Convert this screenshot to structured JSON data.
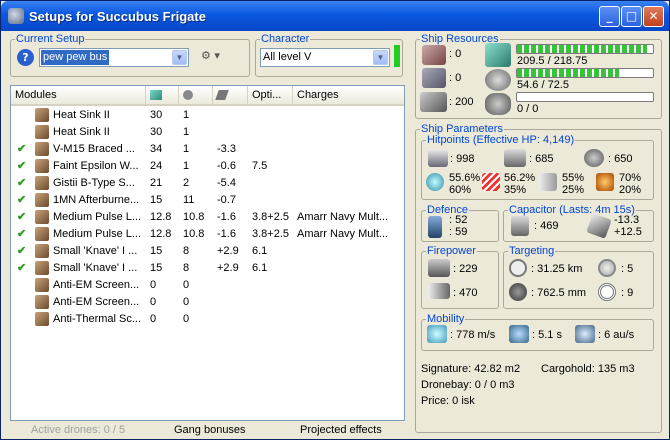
{
  "window": {
    "title": "Setups for Succubus Frigate",
    "minimize": "_",
    "maximize": "□",
    "close": "✕"
  },
  "current_setup": {
    "legend": "Current Setup",
    "value": "pew pew bus"
  },
  "character": {
    "legend": "Character",
    "value": "All level V",
    "status_color": "#22cc22"
  },
  "modules_table": {
    "headers": {
      "modules": "Modules",
      "opti": "Opti...",
      "charges": "Charges"
    },
    "rows": [
      {
        "checked": "",
        "name": "Heat Sink II",
        "c1": "30",
        "c2": "1",
        "c3": "",
        "c4": "",
        "charges": ""
      },
      {
        "checked": "",
        "name": "Heat Sink II",
        "c1": "30",
        "c2": "1",
        "c3": "",
        "c4": "",
        "charges": ""
      },
      {
        "checked": "✔",
        "name": "V-M15 Braced ...",
        "c1": "34",
        "c2": "1",
        "c3": "-3.3",
        "c4": "",
        "charges": ""
      },
      {
        "checked": "✔",
        "name": "Faint Epsilon W...",
        "c1": "24",
        "c2": "1",
        "c3": "-0.6",
        "c4": "7.5",
        "charges": ""
      },
      {
        "checked": "✔",
        "name": "Gistii B-Type S...",
        "c1": "21",
        "c2": "2",
        "c3": "-5.4",
        "c4": "",
        "charges": ""
      },
      {
        "checked": "✔",
        "name": "1MN Afterburne...",
        "c1": "15",
        "c2": "11",
        "c3": "-0.7",
        "c4": "",
        "charges": ""
      },
      {
        "checked": "✔",
        "name": "Medium Pulse L...",
        "c1": "12.8",
        "c2": "10.8",
        "c3": "-1.6",
        "c4": "3.8+2.5",
        "charges": "Amarr Navy Mult..."
      },
      {
        "checked": "✔",
        "name": "Medium Pulse L...",
        "c1": "12.8",
        "c2": "10.8",
        "c3": "-1.6",
        "c4": "3.8+2.5",
        "charges": "Amarr Navy Mult..."
      },
      {
        "checked": "✔",
        "name": "Small 'Knave' I ...",
        "c1": "15",
        "c2": "8",
        "c3": "+2.9",
        "c4": "6.1",
        "charges": ""
      },
      {
        "checked": "✔",
        "name": "Small 'Knave' I ...",
        "c1": "15",
        "c2": "8",
        "c3": "+2.9",
        "c4": "6.1",
        "charges": ""
      },
      {
        "checked": "",
        "name": "Anti-EM Screen...",
        "c1": "0",
        "c2": "0",
        "c3": "",
        "c4": "",
        "charges": ""
      },
      {
        "checked": "",
        "name": "Anti-EM Screen...",
        "c1": "0",
        "c2": "0",
        "c3": "",
        "c4": "",
        "charges": ""
      },
      {
        "checked": "",
        "name": "Anti-Thermal Sc...",
        "c1": "0",
        "c2": "0",
        "c3": "",
        "c4": "",
        "charges": ""
      }
    ]
  },
  "bottom_tabs": {
    "active_drones": "Active drones: 0 / 5",
    "gang_bonuses": "Gang bonuses",
    "projected_effects": "Projected effects"
  },
  "ship_resources": {
    "legend": "Ship Resources",
    "hardpoints_turret": ": 0",
    "hardpoints_launcher": ": 0",
    "calibration": ": 200",
    "cpu": {
      "text": "209.5 / 218.75",
      "fraction": 0.958
    },
    "powergrid": {
      "text": "54.6 / 72.5",
      "fraction": 0.753
    },
    "drone_bandwidth": {
      "text": "0 / 0",
      "fraction": 0.0
    }
  },
  "ship_parameters": {
    "legend": "Ship Parameters",
    "hitpoints": {
      "legend": "Hitpoints (Effective HP: 4,149)",
      "shield_hp": ": 998",
      "armor_hp": ": 685",
      "structure_hp": ": 650",
      "shield_res": [
        "55.6%",
        "60%"
      ],
      "armor_res": [
        "56.2%",
        "35%"
      ],
      "kinetic_res": [
        "55%",
        "25%"
      ],
      "explosive_res": [
        "70%",
        "20%"
      ]
    },
    "defence": {
      "legend": "Defence",
      "v1": ": 52",
      "v2": ": 59"
    },
    "capacitor": {
      "legend": "Capacitor (Lasts: 4m 15s)",
      "amount": ": 469",
      "delta1": "-13.3",
      "delta2": "+12.5"
    },
    "firepower": {
      "legend": "Firepower",
      "v1": ": 229",
      "v2": ": 470"
    },
    "targeting": {
      "legend": "Targeting",
      "range": ": 31.25 km",
      "max_targets": ": 5",
      "resolution": ": 762.5 mm",
      "sensor": ": 9"
    },
    "mobility": {
      "legend": "Mobility",
      "speed": ": 778 m/s",
      "align": ": 5.1 s",
      "warp": ": 6 au/s"
    },
    "signature": "Signature: 42.82 m2",
    "cargohold": "Cargohold: 135 m3",
    "dronebay": "Dronebay: 0 / 0 m3",
    "price": "Price: 0 isk"
  }
}
